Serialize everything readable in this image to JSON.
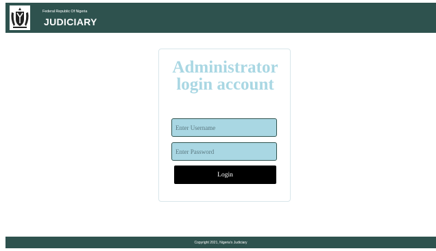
{
  "header": {
    "logo_icon": "coat-of-arms-icon",
    "subtitle": "Federal Republic Of Nigeria",
    "title": "JUDICIARY"
  },
  "login": {
    "title_line1": "Administrator",
    "title_line2": "login account",
    "username_placeholder": "Enter Username",
    "password_placeholder": "Enter Password",
    "button_label": "Login"
  },
  "footer": {
    "copyright": "Copyright 2021, Nigeria's Judiciary"
  },
  "colors": {
    "header_bg": "#2e524e",
    "accent": "#a9d7e3",
    "button_bg": "#000000"
  }
}
